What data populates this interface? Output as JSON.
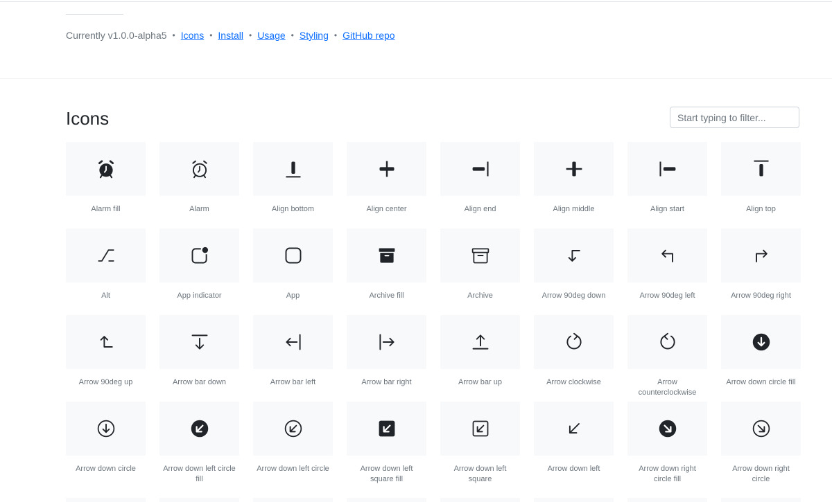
{
  "meta": {
    "version_text": "Currently v1.0.0-alpha5",
    "links": [
      "Icons",
      "Install",
      "Usage",
      "Styling",
      "GitHub repo"
    ]
  },
  "section": {
    "title": "Icons",
    "filter_placeholder": "Start typing to filter..."
  },
  "icons": [
    {
      "name": "Alarm fill",
      "icon": "alarm-fill-icon"
    },
    {
      "name": "Alarm",
      "icon": "alarm-icon"
    },
    {
      "name": "Align bottom",
      "icon": "align-bottom-icon"
    },
    {
      "name": "Align center",
      "icon": "align-center-icon"
    },
    {
      "name": "Align end",
      "icon": "align-end-icon"
    },
    {
      "name": "Align middle",
      "icon": "align-middle-icon"
    },
    {
      "name": "Align start",
      "icon": "align-start-icon"
    },
    {
      "name": "Align top",
      "icon": "align-top-icon"
    },
    {
      "name": "Alt",
      "icon": "alt-icon"
    },
    {
      "name": "App indicator",
      "icon": "app-indicator-icon"
    },
    {
      "name": "App",
      "icon": "app-icon"
    },
    {
      "name": "Archive fill",
      "icon": "archive-fill-icon"
    },
    {
      "name": "Archive",
      "icon": "archive-icon"
    },
    {
      "name": "Arrow 90deg down",
      "icon": "arrow-90deg-down-icon"
    },
    {
      "name": "Arrow 90deg left",
      "icon": "arrow-90deg-left-icon"
    },
    {
      "name": "Arrow 90deg right",
      "icon": "arrow-90deg-right-icon"
    },
    {
      "name": "Arrow 90deg up",
      "icon": "arrow-90deg-up-icon"
    },
    {
      "name": "Arrow bar down",
      "icon": "arrow-bar-down-icon"
    },
    {
      "name": "Arrow bar left",
      "icon": "arrow-bar-left-icon"
    },
    {
      "name": "Arrow bar right",
      "icon": "arrow-bar-right-icon"
    },
    {
      "name": "Arrow bar up",
      "icon": "arrow-bar-up-icon"
    },
    {
      "name": "Arrow clockwise",
      "icon": "arrow-clockwise-icon"
    },
    {
      "name": "Arrow counterclockwise",
      "icon": "arrow-counterclockwise-icon"
    },
    {
      "name": "Arrow down circle fill",
      "icon": "arrow-down-circle-fill-icon"
    },
    {
      "name": "Arrow down circle",
      "icon": "arrow-down-circle-icon"
    },
    {
      "name": "Arrow down left circle fill",
      "icon": "arrow-down-left-circle-fill-icon"
    },
    {
      "name": "Arrow down left circle",
      "icon": "arrow-down-left-circle-icon"
    },
    {
      "name": "Arrow down left square fill",
      "icon": "arrow-down-left-square-fill-icon"
    },
    {
      "name": "Arrow down left square",
      "icon": "arrow-down-left-square-icon"
    },
    {
      "name": "Arrow down left",
      "icon": "arrow-down-left-icon"
    },
    {
      "name": "Arrow down right circle fill",
      "icon": "arrow-down-right-circle-fill-icon"
    },
    {
      "name": "Arrow down right circle",
      "icon": "arrow-down-right-circle-icon"
    }
  ],
  "colors": {
    "icon": "#212529",
    "tile": "#f8f9fa",
    "caption": "#6c757d",
    "link": "#0d6efd"
  }
}
